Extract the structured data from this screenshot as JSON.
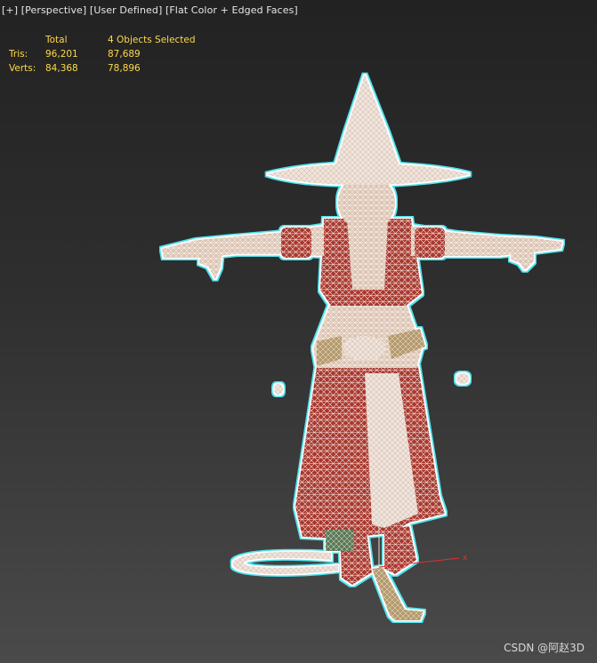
{
  "viewport": {
    "labels": [
      "[+]",
      "[Perspective]",
      "[User Defined]",
      "[Flat Color + Edged Faces]"
    ]
  },
  "stats": {
    "header": {
      "total": "Total",
      "selected": "4 Objects Selected"
    },
    "rows": [
      {
        "label": "Tris:",
        "total": "96,201",
        "selected": "87,689"
      },
      {
        "label": "Verts:",
        "total": "84,368",
        "selected": "78,896"
      }
    ]
  },
  "gizmo": {
    "axis_label": "x"
  },
  "watermark": "CSDN @阿赵3D",
  "colors": {
    "outline": "#4fe3ec",
    "wire": "#ffffff",
    "red_cloth": "#a8382f",
    "skin": "#e2cbbb",
    "stats_text": "#ffd84a"
  }
}
